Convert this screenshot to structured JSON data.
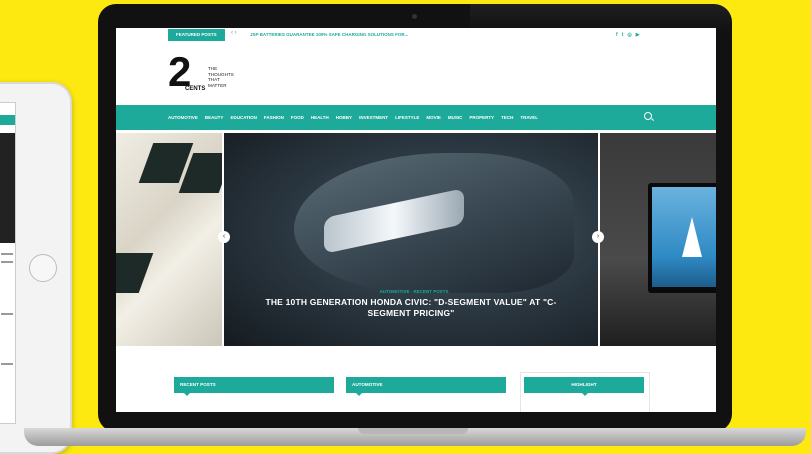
{
  "colors": {
    "background": "#fde910",
    "accent": "#1eaa9a"
  },
  "topbar": {
    "featured_label": "FEATURED POSTS",
    "arrows": "‹ ›",
    "ticker": "JSP BATTERIES GUARANTEE 100% SAFE CHARGING SOLUTIONS FOR...",
    "social_icons": [
      "f",
      "t",
      "instagram",
      "youtube"
    ]
  },
  "logo": {
    "numeral": "2",
    "word": "CENTS",
    "tagline_lines": [
      "THE",
      "THOUGHTS",
      "THAT",
      "MATTER"
    ]
  },
  "nav": {
    "items": [
      "AUTOMOTIVE",
      "BEAUTY",
      "EDUCATION",
      "FASHION",
      "FOOD",
      "HEALTH",
      "HOBBY",
      "INVESTMENT",
      "LIFESTYLE",
      "MOVIE",
      "MUSIC",
      "PROPERTY",
      "TECH",
      "TRAVEL"
    ],
    "search_icon": "search-icon"
  },
  "slider": {
    "meta": "AUTOMOTIVE · RECENT POSTS",
    "title": "THE 10TH GENERATION HONDA CIVIC: \"D-SEGMENT VALUE\" AT \"C-SEGMENT PRICING\"",
    "prev": "‹",
    "next": "›"
  },
  "widgets": {
    "recent": "RECENT POSTS",
    "automotive": "AUTOMOTIVE",
    "highlight": "HIGHLIGHT"
  }
}
